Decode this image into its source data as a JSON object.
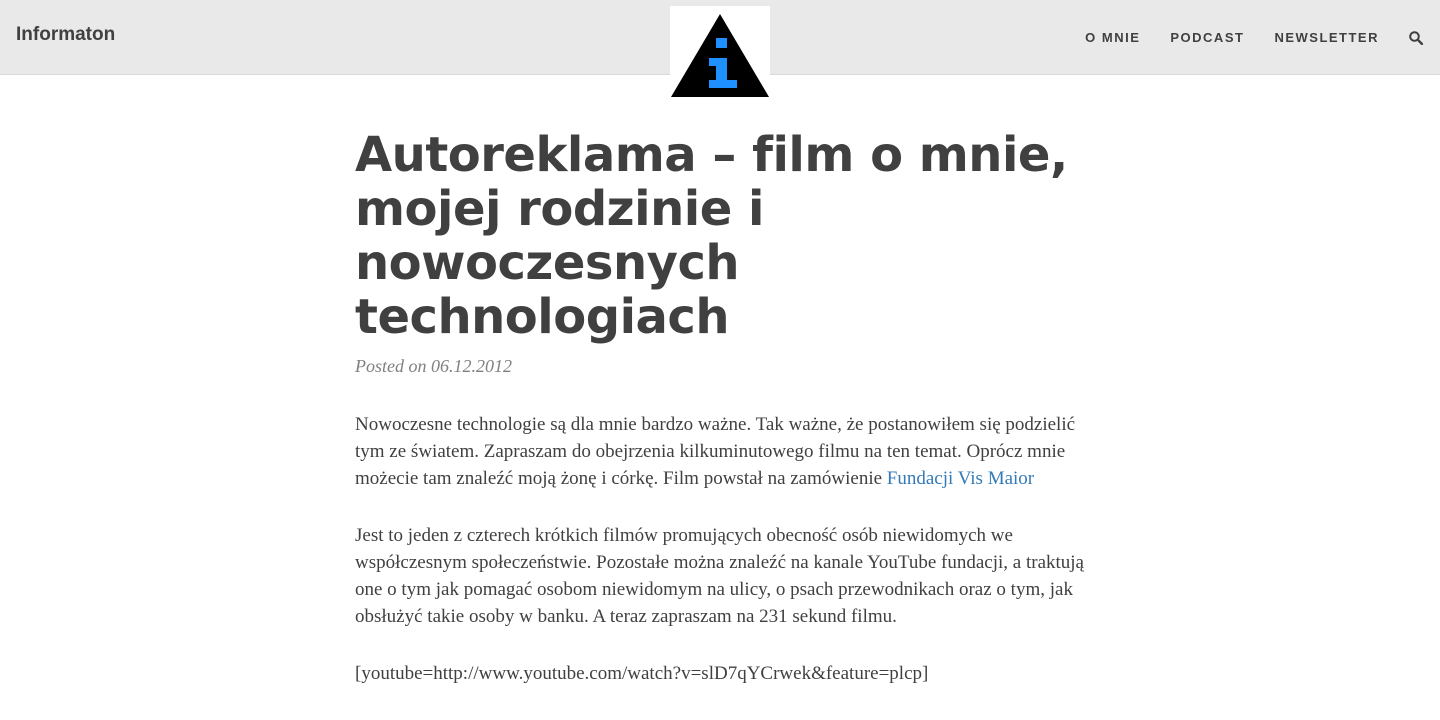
{
  "header": {
    "brand": "Informaton",
    "logo_icon": "info-triangle-logo-icon",
    "nav": [
      {
        "label": "O MNIE"
      },
      {
        "label": "PODCAST"
      },
      {
        "label": "NEWSLETTER"
      }
    ],
    "search_icon": "search-icon"
  },
  "post": {
    "title": "Autoreklama – film o mnie, mojej rodzinie i nowoczesnych technologiach",
    "meta": "Posted on 06.12.2012",
    "p1_text": "Nowoczesne technologie są dla mnie bardzo ważne. Tak ważne, że postanowiłem się podzielić tym ze światem. Zapraszam do obejrzenia kilkuminutowego filmu na ten temat. Oprócz mnie możecie tam znaleźć moją żonę i córkę. Film powstał na zamówienie ",
    "p1_link": "Fundacji Vis Maior",
    "p2_text": "Jest to jeden z czterech krótkich filmów promujących obecność osób niewidomych we współczesnym społeczeństwie. Pozostałe można znaleźć na kanale YouTube fundacji, a traktują one o tym jak pomagać osobom niewidomym na ulicy, o psach przewodnikach oraz o tym, jak obsłużyć takie osoby w banku. A teraz zapraszam na 231 sekund filmu.",
    "p3_text": "[youtube=http://www.youtube.com/watch?v=slD7qYCrwek&feature=plcp]"
  },
  "colors": {
    "header_bg": "#e9e9e9",
    "text": "#404040",
    "link": "#337ab7",
    "logo_blue": "#1e90ff"
  }
}
